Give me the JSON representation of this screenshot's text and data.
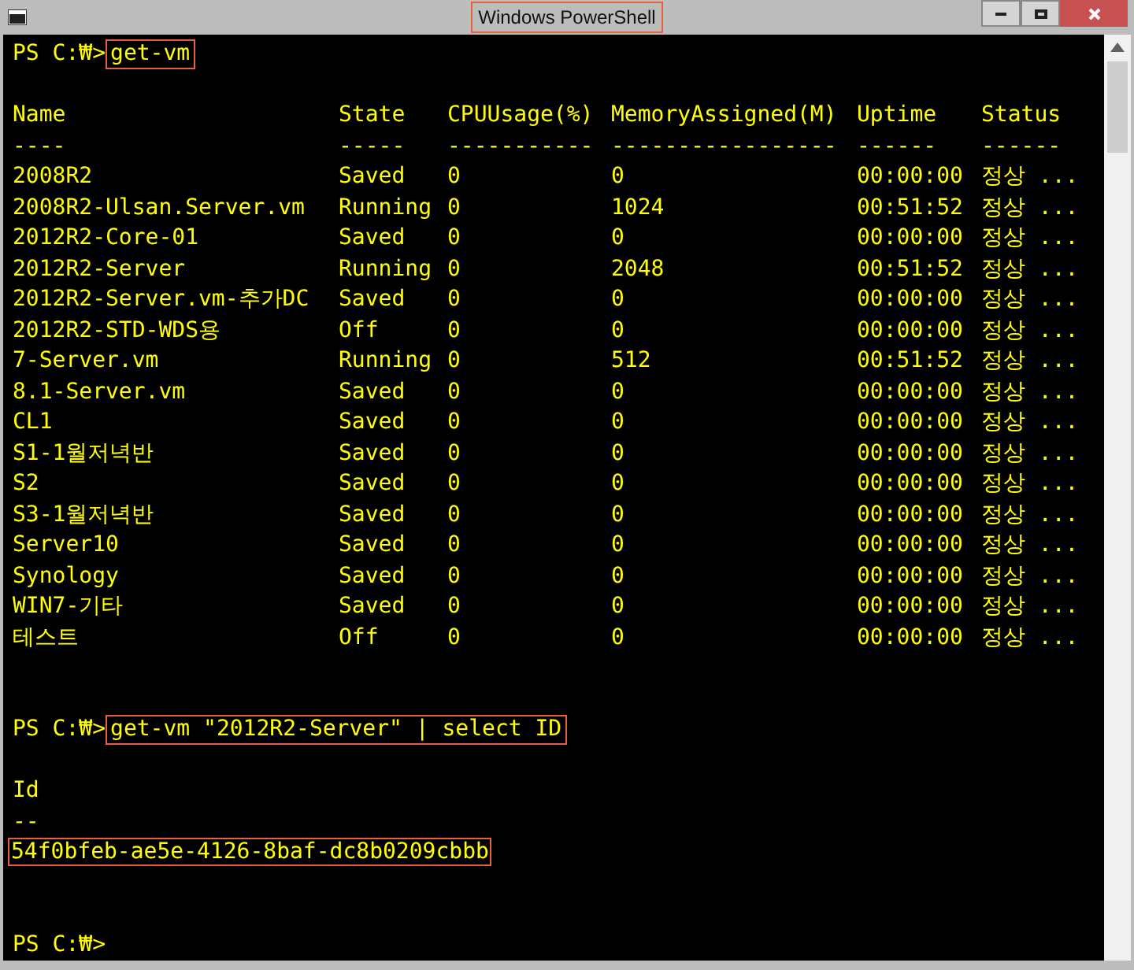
{
  "window": {
    "title": "Windows PowerShell",
    "title_highlighted": true
  },
  "console": {
    "blocks": [
      {
        "kind": "command",
        "prompt": "PS C:₩>",
        "command": "get-vm",
        "highlighted": true
      },
      {
        "kind": "table",
        "columns": [
          {
            "header": "Name",
            "rule": "----"
          },
          {
            "header": "State",
            "rule": "-----"
          },
          {
            "header": "CPUUsage(%)",
            "rule": "-----------"
          },
          {
            "header": "MemoryAssigned(M)",
            "rule": "-----------------"
          },
          {
            "header": "Uptime",
            "rule": "------"
          },
          {
            "header": "Status",
            "rule": "------"
          }
        ],
        "rows": [
          {
            "cells": [
              "2008R2",
              "Saved",
              "0",
              "0",
              "00:00:00",
              "정상 ..."
            ],
            "highlighted": false
          },
          {
            "cells": [
              "2008R2-Ulsan.Server.vm",
              "Running",
              "0",
              "1024",
              "00:51:52",
              "정상 ..."
            ],
            "highlighted": false
          },
          {
            "cells": [
              "2012R2-Core-01",
              "Saved",
              "0",
              "0",
              "00:00:00",
              "정상 ..."
            ],
            "highlighted": false
          },
          {
            "cells": [
              "2012R2-Server",
              "Running",
              "0",
              "2048",
              "00:51:52",
              "정상 ..."
            ],
            "highlighted": false
          },
          {
            "cells": [
              "2012R2-Server.vm-추가DC",
              "Saved",
              "0",
              "0",
              "00:00:00",
              "정상 ..."
            ],
            "highlighted": false
          },
          {
            "cells": [
              "2012R2-STD-WDS용",
              "Off",
              "0",
              "0",
              "00:00:00",
              "정상 ..."
            ],
            "highlighted": false
          },
          {
            "cells": [
              "7-Server.vm",
              "Running",
              "0",
              "512",
              "00:51:52",
              "정상 ..."
            ],
            "highlighted": false
          },
          {
            "cells": [
              "8.1-Server.vm",
              "Saved",
              "0",
              "0",
              "00:00:00",
              "정상 ..."
            ],
            "highlighted": false
          },
          {
            "cells": [
              "CL1",
              "Saved",
              "0",
              "0",
              "00:00:00",
              "정상 ..."
            ],
            "highlighted": false
          },
          {
            "cells": [
              "S1-1월저녁반",
              "Saved",
              "0",
              "0",
              "00:00:00",
              "정상 ..."
            ],
            "highlighted": false
          },
          {
            "cells": [
              "S2",
              "Saved",
              "0",
              "0",
              "00:00:00",
              "정상 ..."
            ],
            "highlighted": false
          },
          {
            "cells": [
              "S3-1월저녁반",
              "Saved",
              "0",
              "0",
              "00:00:00",
              "정상 ..."
            ],
            "highlighted": false
          },
          {
            "cells": [
              "Server10",
              "Saved",
              "0",
              "0",
              "00:00:00",
              "정상 ..."
            ],
            "highlighted": false
          },
          {
            "cells": [
              "Synology",
              "Saved",
              "0",
              "0",
              "00:00:00",
              "정상 ..."
            ],
            "highlighted": false
          },
          {
            "cells": [
              "WIN7-기타",
              "Saved",
              "0",
              "0",
              "00:00:00",
              "정상 ..."
            ],
            "highlighted": false
          },
          {
            "cells": [
              "테스트",
              "Off",
              "0",
              "0",
              "00:00:00",
              "정상 ..."
            ],
            "highlighted": false
          }
        ]
      },
      {
        "kind": "command",
        "prompt": "PS C:₩>",
        "command": "get-vm \"2012R2-Server\" | select ID",
        "highlighted": true
      },
      {
        "kind": "table",
        "columns": [
          {
            "header": "Id",
            "rule": "--"
          }
        ],
        "rows": [
          {
            "cells": [
              "54f0bfeb-ae5e-4126-8baf-dc8b0209cbbb"
            ],
            "highlighted": true
          }
        ]
      },
      {
        "kind": "prompt",
        "prompt": "PS C:₩>"
      }
    ]
  }
}
